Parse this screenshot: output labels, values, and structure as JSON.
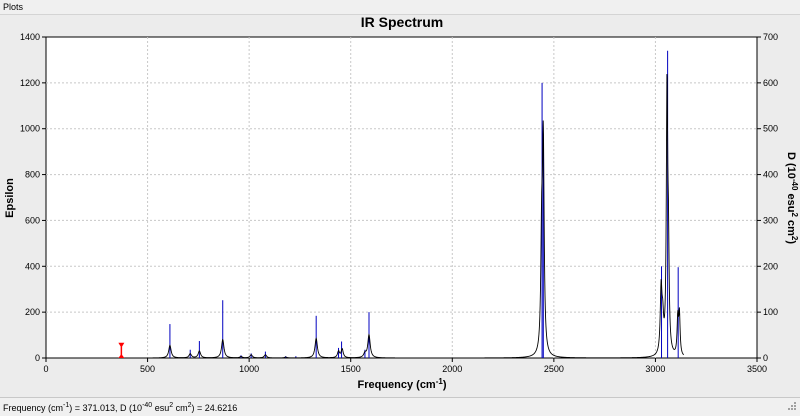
{
  "window": {
    "title": "Plots"
  },
  "status": {
    "freq_label": "Frequency (cm",
    "freq_sup": "-1",
    "freq_value": ") = 371.013, D (10",
    "d_sup1": "-40",
    "d_mid": " esu",
    "d_sup2": "2",
    "d_tail": " cm",
    "d_sup3": "2",
    "d_value": ") = 24.6216"
  },
  "colors": {
    "spectrum_line": "#000000",
    "stick_line": "#0000c0",
    "cursor_marker": "#ff0000",
    "grid": "#c8c8c8"
  },
  "chart_data": {
    "type": "line",
    "title": "IR Spectrum",
    "xlabel": "Frequency (cm-1)",
    "ylabel": "Epsilon",
    "y2label": "D (10-40 esu2 cm2)",
    "xlim": [
      0,
      3500
    ],
    "ylim": [
      0,
      1400
    ],
    "y2lim": [
      0,
      700
    ],
    "x_ticks": [
      0,
      500,
      1000,
      1500,
      2000,
      2500,
      3000,
      3500
    ],
    "y_ticks": [
      0,
      200,
      400,
      600,
      800,
      1000,
      1200,
      1400
    ],
    "y2_ticks": [
      0,
      100,
      200,
      300,
      400,
      500,
      600,
      700
    ],
    "grid": true,
    "cursor": {
      "x": 371.013,
      "d": 24.6216
    },
    "series": [
      {
        "type": "sticks",
        "axis": "right",
        "x": [
          610,
          710,
          755,
          870,
          960,
          1010,
          1080,
          1180,
          1230,
          1330,
          1440,
          1455,
          1570,
          1590,
          2442,
          2448,
          3030,
          3060,
          3112
        ],
        "values": [
          74,
          18,
          37,
          126,
          6,
          10,
          14,
          4,
          4,
          92,
          22,
          36,
          18,
          100,
          600,
          460,
          200,
          670,
          198
        ]
      },
      {
        "type": "spectrum",
        "axis": "left",
        "peaks": [
          {
            "x": 610,
            "epsilon": 55,
            "width": 7
          },
          {
            "x": 710,
            "epsilon": 18,
            "width": 7
          },
          {
            "x": 755,
            "epsilon": 30,
            "width": 7
          },
          {
            "x": 870,
            "epsilon": 80,
            "width": 7
          },
          {
            "x": 960,
            "epsilon": 6,
            "width": 7
          },
          {
            "x": 1010,
            "epsilon": 14,
            "width": 7
          },
          {
            "x": 1080,
            "epsilon": 14,
            "width": 7
          },
          {
            "x": 1180,
            "epsilon": 4,
            "width": 7
          },
          {
            "x": 1330,
            "epsilon": 85,
            "width": 7
          },
          {
            "x": 1440,
            "epsilon": 28,
            "width": 6
          },
          {
            "x": 1458,
            "epsilon": 38,
            "width": 6
          },
          {
            "x": 1570,
            "epsilon": 18,
            "width": 7
          },
          {
            "x": 1590,
            "epsilon": 100,
            "width": 7
          },
          {
            "x": 2440,
            "epsilon": 470,
            "width": 5
          },
          {
            "x": 2448,
            "epsilon": 900,
            "width": 5
          },
          {
            "x": 3028,
            "epsilon": 280,
            "width": 5
          },
          {
            "x": 3036,
            "epsilon": 130,
            "width": 5
          },
          {
            "x": 3057,
            "epsilon": 1150,
            "width": 4
          },
          {
            "x": 3064,
            "epsilon": 400,
            "width": 4
          },
          {
            "x": 3110,
            "epsilon": 160,
            "width": 4
          },
          {
            "x": 3118,
            "epsilon": 180,
            "width": 4
          }
        ]
      }
    ]
  }
}
